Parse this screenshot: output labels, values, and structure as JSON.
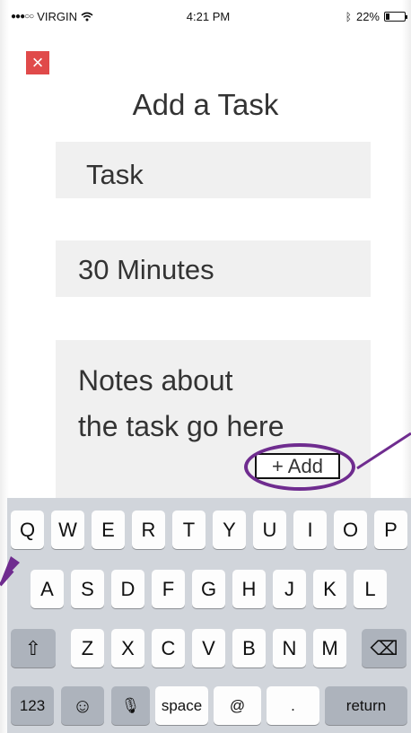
{
  "status_bar": {
    "carrier": "VIRGIN",
    "signal": "●●●○○",
    "time": "4:21 PM",
    "battery_percent": "22%",
    "battery_level": 0.22
  },
  "header": {
    "close_symbol": "×",
    "title": "Add a Task"
  },
  "form": {
    "task_placeholder": "Task",
    "duration_value": "30 Minutes",
    "notes_placeholder": "Notes about\nthe task go here",
    "add_label": "+ Add"
  },
  "keyboard": {
    "row1": [
      "Q",
      "W",
      "E",
      "R",
      "T",
      "Y",
      "U",
      "I",
      "O",
      "P"
    ],
    "row2": [
      "A",
      "S",
      "D",
      "F",
      "G",
      "H",
      "J",
      "K",
      "L"
    ],
    "row3": [
      "Z",
      "X",
      "C",
      "V",
      "B",
      "N",
      "M"
    ],
    "num_label": "123",
    "emoji_symbol": "☺",
    "mic_symbol": "🎙",
    "space_label": "space",
    "at_label": "@",
    "dot_label": ".",
    "return_label": "return",
    "shift_symbol": "⇧",
    "delete_symbol": "⌫"
  },
  "annotation": {
    "color": "#6f2c8f"
  },
  "colors": {
    "close_red": "#e04a4a",
    "field_bg": "#f0f0f0",
    "keyboard_bg": "#d1d5db"
  }
}
